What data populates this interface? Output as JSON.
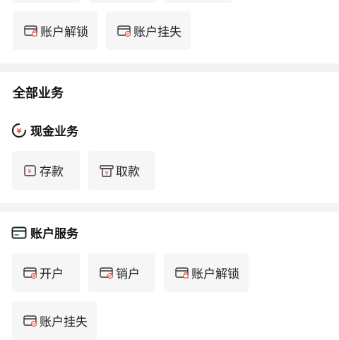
{
  "top": {
    "tiles": [
      {
        "label": "账户解锁",
        "icon": "card-unlock-icon"
      },
      {
        "label": "账户挂失",
        "icon": "card-loss-icon"
      }
    ]
  },
  "all_services": {
    "title": "全部业务",
    "cash": {
      "title": "现金业务",
      "icon": "yuan-circle-icon",
      "tiles": [
        {
          "label": "存款",
          "icon": "deposit-icon"
        },
        {
          "label": "取款",
          "icon": "withdraw-icon"
        }
      ]
    },
    "account": {
      "title": "账户服务",
      "icon": "card-icon",
      "tiles": [
        {
          "label": "开户",
          "icon": "card-open-icon"
        },
        {
          "label": "销户",
          "icon": "card-close-icon"
        },
        {
          "label": "账户解锁",
          "icon": "card-unlock-icon"
        },
        {
          "label": "账户挂失",
          "icon": "card-loss-icon"
        }
      ]
    }
  },
  "colors": {
    "accent": "#e05a4a",
    "tile_bg": "#f6f6f6",
    "band": "#f3f3f3"
  }
}
